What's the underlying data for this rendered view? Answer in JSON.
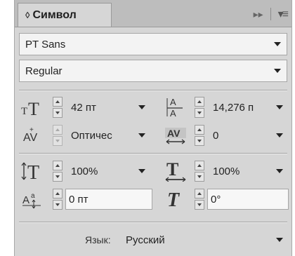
{
  "panel": {
    "tab_title": "Символ",
    "tab_updown_glyph": "◊",
    "forward_glyph": "▸▸",
    "menu_glyph": "▾≡"
  },
  "font": {
    "family": "PT Sans",
    "style": "Regular"
  },
  "metrics": {
    "size": "42 пт",
    "leading": "14,276 п",
    "kerning": "Оптичес",
    "tracking": "0",
    "vertical_scale": "100%",
    "horizontal_scale": "100%",
    "baseline_shift": "0 пт",
    "skew": "0°"
  },
  "language": {
    "label": "Язык:",
    "value": "Русский"
  },
  "icons": {
    "font_size": "font-size-icon",
    "leading": "leading-icon",
    "kerning": "kerning-icon",
    "tracking": "tracking-icon",
    "vertical_scale": "vertical-scale-icon",
    "horizontal_scale": "horizontal-scale-icon",
    "baseline_shift": "baseline-shift-icon",
    "skew": "skew-icon"
  },
  "colors": {
    "panel_bg": "#d6d6d6",
    "tab_bar_bg": "#bdbdbd",
    "field_bg": "#f3f3f3"
  }
}
